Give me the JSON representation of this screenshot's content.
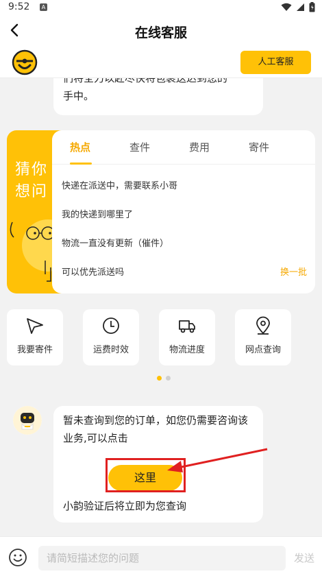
{
  "status_bar": {
    "time": "9:52",
    "app_icon_letter": "A"
  },
  "header": {
    "title": "在线客服"
  },
  "subbar": {
    "human_service_label": "人工客服"
  },
  "previous_message": {
    "line1": "们将全力以赴尽快将包裹送达到您的",
    "line2": "手中。"
  },
  "guess_card": {
    "side_title_line1": "猜你",
    "side_title_line2": "想问",
    "tabs": [
      "热点",
      "查件",
      "费用",
      "寄件"
    ],
    "active_tab": 0,
    "questions": [
      "快递在派送中，需要联系小哥",
      "我的快递到哪里了",
      "物流一直没有更新（催件）",
      "可以优先派送吗"
    ],
    "refresh_label": "换一批"
  },
  "services": [
    {
      "label": "我要寄件",
      "icon": "paper-plane-icon"
    },
    {
      "label": "运费时效",
      "icon": "clock-icon"
    },
    {
      "label": "物流进度",
      "icon": "truck-icon"
    },
    {
      "label": "网点查询",
      "icon": "location-pin-icon"
    }
  ],
  "pager": {
    "pages": 2,
    "current": 1
  },
  "bot_message": {
    "text": "暂未查询到您的订单，如您仍需要咨询该业务,可以点击",
    "button_label": "这里",
    "tail": "小韵验证后将立即为您查询"
  },
  "input_bar": {
    "placeholder": "请简短描述您的问题",
    "send_label": "发送"
  },
  "colors": {
    "accent": "#ffc107",
    "accent_text": "#f5a800",
    "annotation_red": "#e02020"
  }
}
